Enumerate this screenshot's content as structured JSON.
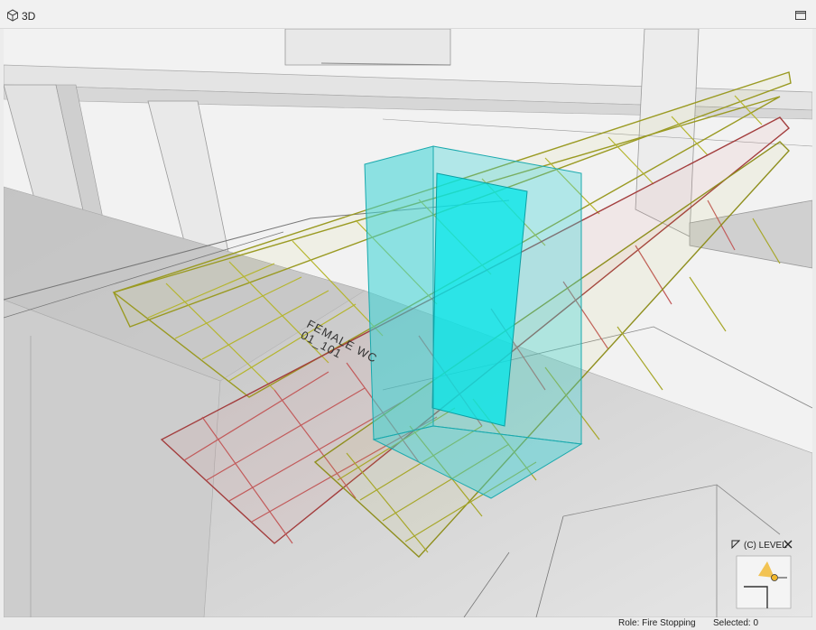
{
  "window": {
    "title": "3D",
    "icon": "cube-icon",
    "maximize_icon": "maximize-icon"
  },
  "viewport": {
    "room_label": {
      "name": "FEMALE WC",
      "number": "01_101"
    },
    "tray_colors": {
      "upper_tray": "#c9c94a",
      "middle_tray": "#d96b6b",
      "lower_tray": "#b9b93e"
    },
    "fire_stopping_color": "#38d3d6"
  },
  "navigator": {
    "level_label": "(C) LEVEL",
    "corner_icon": "corner-arrow-icon",
    "close_icon": "close-x-icon"
  },
  "status": {
    "role": "Role: Fire Stopping",
    "selected": "Selected: 0"
  }
}
